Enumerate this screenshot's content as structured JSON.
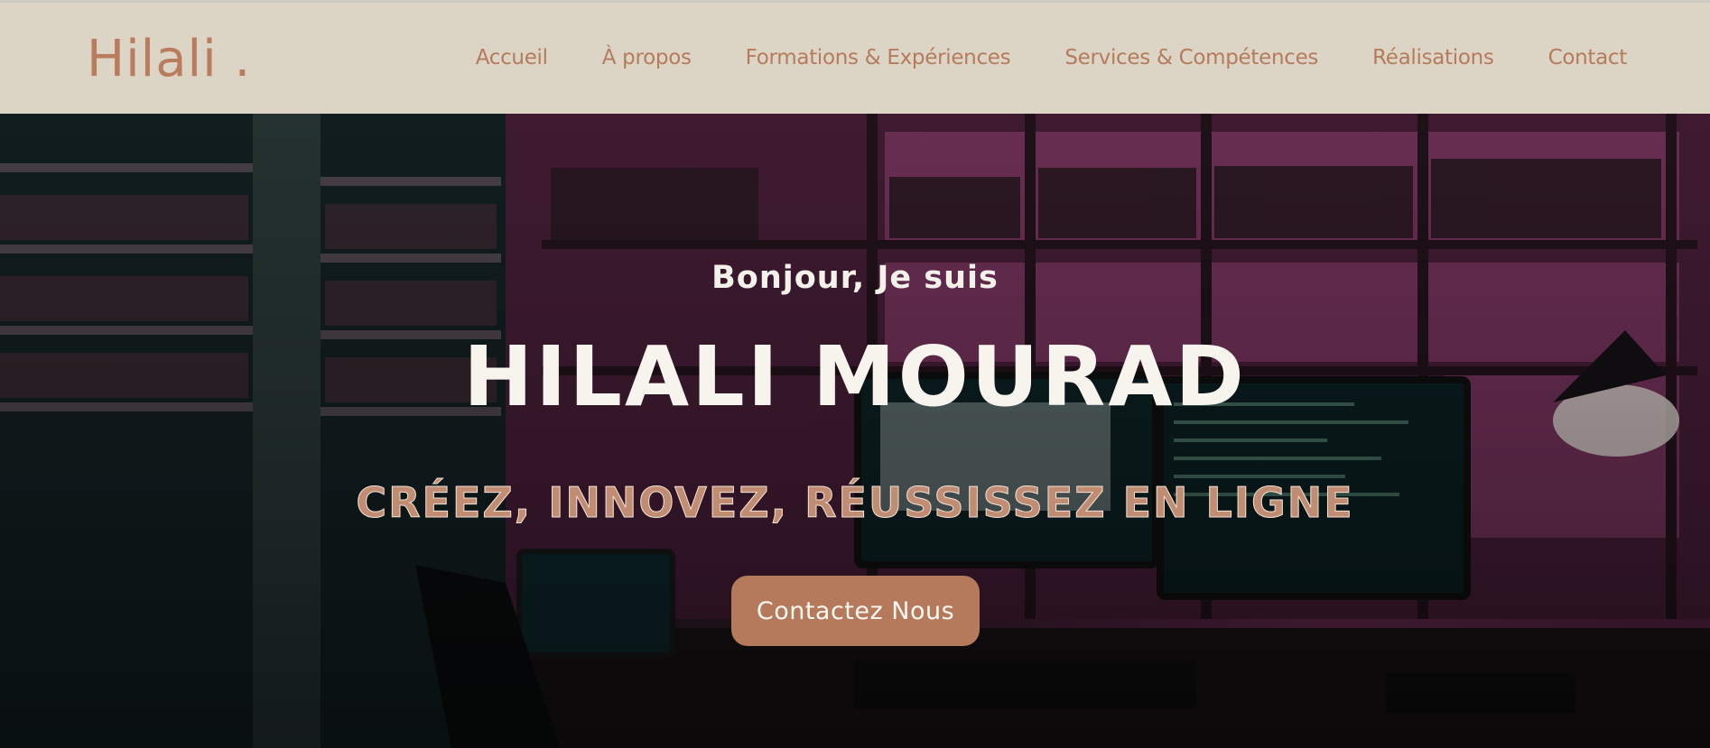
{
  "brand": {
    "logo_text": "Hilali ."
  },
  "nav": {
    "items": [
      {
        "label": "Accueil"
      },
      {
        "label": "À propos"
      },
      {
        "label": "Formations & Expériences"
      },
      {
        "label": "Services & Compétences"
      },
      {
        "label": "Réalisations"
      },
      {
        "label": "Contact"
      }
    ]
  },
  "hero": {
    "greeting": "Bonjour, Je suis",
    "name": "HILALI MOURAD",
    "tagline": "CRÉEZ, INNOVEZ, RÉUSSISSEZ EN LIGNE",
    "cta_label": "Contactez Nous"
  },
  "colors": {
    "accent": "#b47a5b",
    "nav_bg": "#dcd5c5",
    "nav_text": "#b57b5c",
    "hero_text": "#f7f4ee"
  }
}
